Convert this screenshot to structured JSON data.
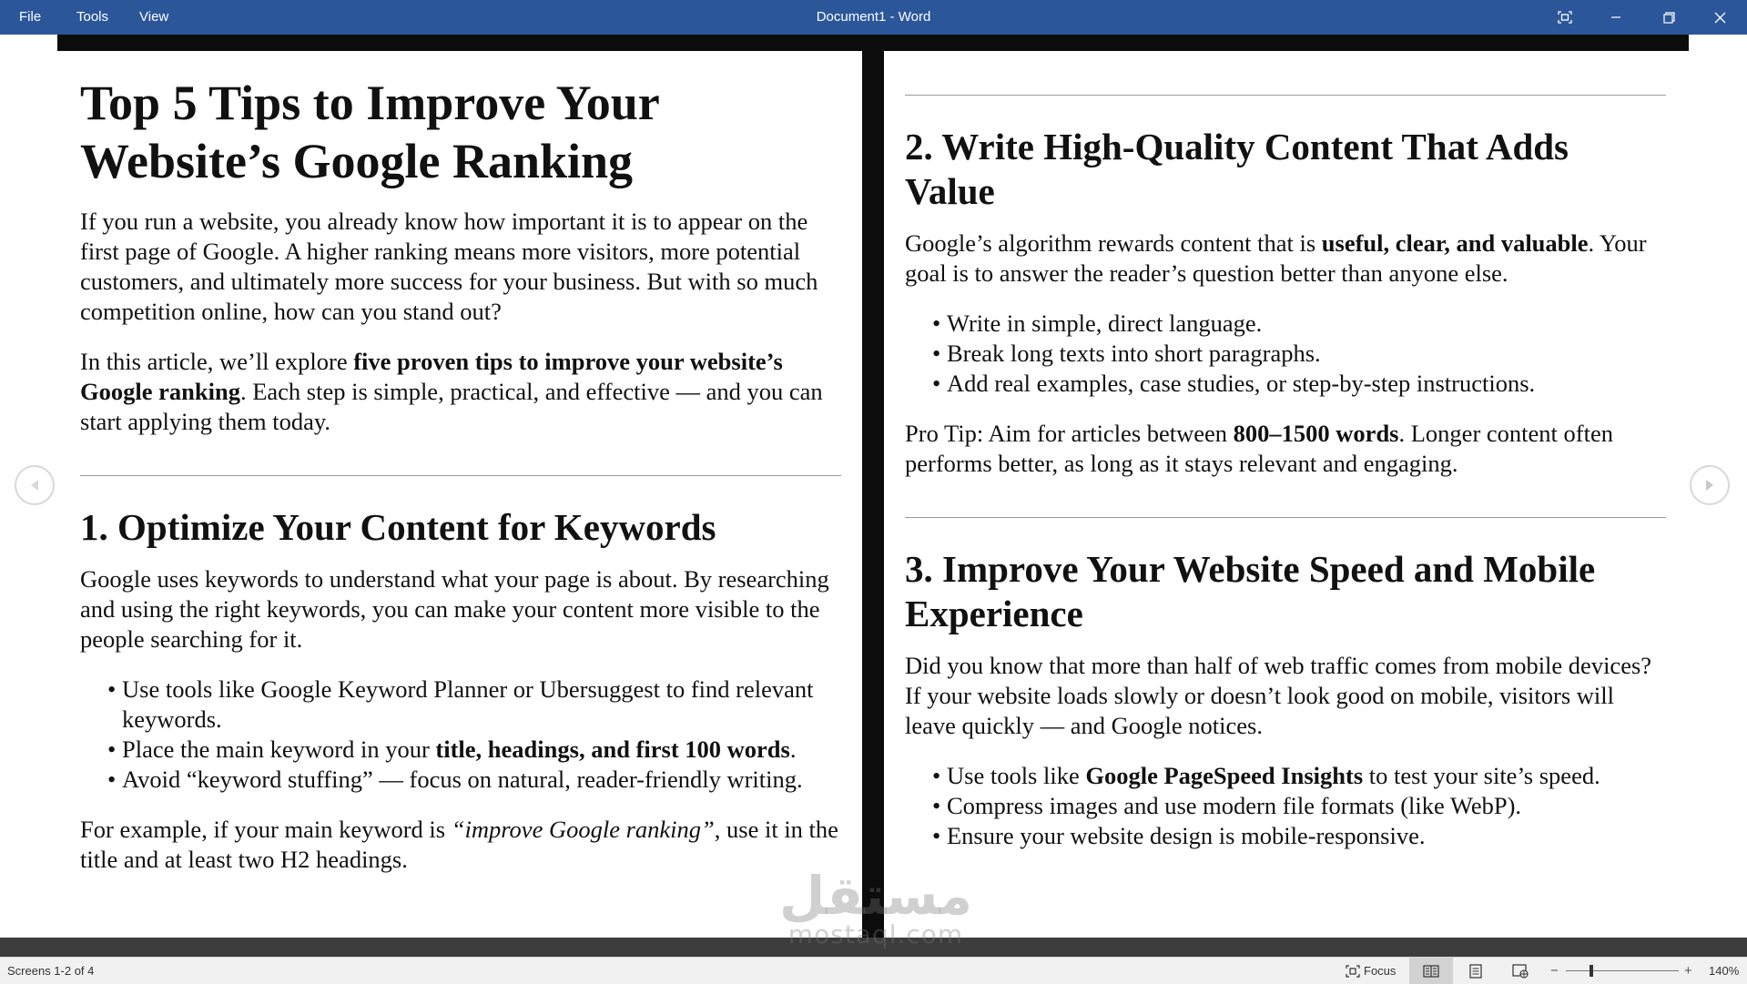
{
  "app": {
    "window_title": "Document1 - Word",
    "menu": [
      "File",
      "Tools",
      "View"
    ]
  },
  "left_page": {
    "title": "Top 5 Tips to Improve Your Website’s Google Ranking",
    "intro_1": "If you run a website, you already know how important it is to appear on the first page of Google. A higher ranking means more visitors, more potential customers, and ultimately more success for your business. But with so much competition online, how can you stand out?",
    "intro_2_a": "In this article, we’ll explore ",
    "intro_2_b": "five proven tips to improve your website’s Google ranking",
    "intro_2_c": ". Each step is simple, practical, and effective — and you can start applying them today.",
    "h1": "1. Optimize Your Content for Keywords",
    "p1": "Google uses keywords to understand what your page is about. By researching and using the right keywords, you can make your content more visible to the people searching for it.",
    "bullets": {
      "b1": "Use tools like Google Keyword Planner or Ubersuggest to find relevant keywords.",
      "b2_a": "Place the main keyword in your ",
      "b2_b": "title, headings, and first 100 words",
      "b2_c": ".",
      "b3": "Avoid “keyword stuffing” — focus on natural, reader-friendly writing."
    },
    "p2_a": "For example, if your main keyword is ",
    "p2_b": "“improve Google ranking”",
    "p2_c": ", use it in the title and at least two H2 headings."
  },
  "right_page": {
    "h2": "2. Write High-Quality Content That Adds Value",
    "p1_a": "Google’s algorithm rewards content that is ",
    "p1_b": "useful, clear, and valuable",
    "p1_c": ". Your goal is to answer the reader’s question better than anyone else.",
    "bullets1": [
      "Write in simple, direct language.",
      "Break long texts into short paragraphs.",
      "Add real examples, case studies, or step-by-step instructions."
    ],
    "tip_a": "Pro Tip: Aim for articles between ",
    "tip_b": "800–1500 words",
    "tip_c": ". Longer content often performs better, as long as it stays relevant and engaging.",
    "h3": "3. Improve Your Website Speed and Mobile Experience",
    "p2": "Did you know that more than half of web traffic comes from mobile devices? If your website loads slowly or doesn’t look good on mobile, visitors will leave quickly — and Google notices.",
    "bullets2": {
      "b1_a": "Use tools like ",
      "b1_b": "Google PageSpeed Insights",
      "b1_c": " to test your site’s speed.",
      "b2": "Compress images and use modern file formats (like WebP).",
      "b3": "Ensure your website design is mobile-responsive."
    }
  },
  "status": {
    "screens": "Screens 1-2 of 4",
    "focus": "Focus",
    "zoom": "140%",
    "zoom_minus": "−",
    "zoom_plus": "+"
  },
  "watermark": {
    "arabic": "مستقل",
    "latin": "mostaql.com"
  },
  "colors": {
    "titlebar": "#2b579a",
    "band": "#0c0c0c",
    "statusbar": "#f1f1f1"
  },
  "icons": [
    "focus-mode-icon",
    "minimize-icon",
    "restore-icon",
    "close-icon",
    "prev-screen-icon",
    "next-screen-icon",
    "read-mode-icon",
    "print-layout-icon",
    "web-layout-icon"
  ]
}
